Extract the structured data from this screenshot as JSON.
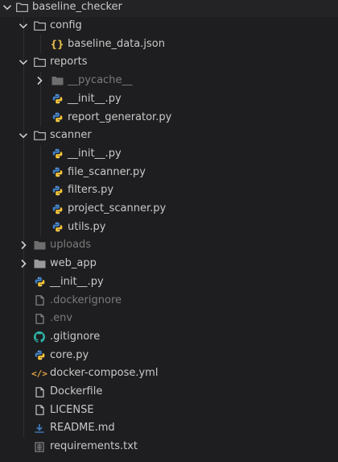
{
  "explorer": {
    "items": [
      {
        "label": "baseline_checker",
        "type": "folder-open",
        "depth": 0,
        "expanded": true
      },
      {
        "label": "config",
        "type": "folder-open",
        "depth": 1,
        "expanded": true
      },
      {
        "label": "baseline_data.json",
        "type": "json",
        "depth": 2
      },
      {
        "label": "reports",
        "type": "folder-open",
        "depth": 1,
        "expanded": true
      },
      {
        "label": "__pycache__",
        "type": "folder-closed-dim",
        "depth": 2,
        "expanded": false
      },
      {
        "label": "__init__.py",
        "type": "python",
        "depth": 2
      },
      {
        "label": "report_generator.py",
        "type": "python",
        "depth": 2
      },
      {
        "label": "scanner",
        "type": "folder-open",
        "depth": 1,
        "expanded": true
      },
      {
        "label": "__init__.py",
        "type": "python",
        "depth": 2
      },
      {
        "label": "file_scanner.py",
        "type": "python",
        "depth": 2
      },
      {
        "label": "filters.py",
        "type": "python",
        "depth": 2
      },
      {
        "label": "project_scanner.py",
        "type": "python",
        "depth": 2
      },
      {
        "label": "utils.py",
        "type": "python",
        "depth": 2
      },
      {
        "label": "uploads",
        "type": "folder-closed-dim",
        "depth": 1,
        "expanded": false
      },
      {
        "label": "web_app",
        "type": "folder-closed",
        "depth": 1,
        "expanded": false
      },
      {
        "label": "__init__.py",
        "type": "python",
        "depth": 1
      },
      {
        "label": ".dockerignore",
        "type": "file-dim",
        "depth": 1
      },
      {
        "label": ".env",
        "type": "file-dim",
        "depth": 1
      },
      {
        "label": ".gitignore",
        "type": "github",
        "depth": 1
      },
      {
        "label": "core.py",
        "type": "python",
        "depth": 1
      },
      {
        "label": "docker-compose.yml",
        "type": "code",
        "depth": 1
      },
      {
        "label": "Dockerfile",
        "type": "file",
        "depth": 1
      },
      {
        "label": "LICENSE",
        "type": "file",
        "depth": 1
      },
      {
        "label": "README.md",
        "type": "markdown",
        "depth": 1
      },
      {
        "label": "requirements.txt",
        "type": "text-file",
        "depth": 1
      }
    ]
  },
  "icons": {
    "folder": "folder-icon",
    "python": "python-icon",
    "json": "json-braces-icon",
    "file": "file-icon",
    "github": "github-icon",
    "code": "code-brackets-icon",
    "markdown": "markdown-icon",
    "text": "text-file-icon"
  },
  "colors": {
    "background": "#1e1e20",
    "text": "#c9c9c9",
    "dim_text": "#7b7b7b",
    "python_blue": "#3f7cc0",
    "python_yellow": "#f5c53a",
    "json": "#e0b94a",
    "code": "#e7a844",
    "github": "#2fb5a8"
  }
}
